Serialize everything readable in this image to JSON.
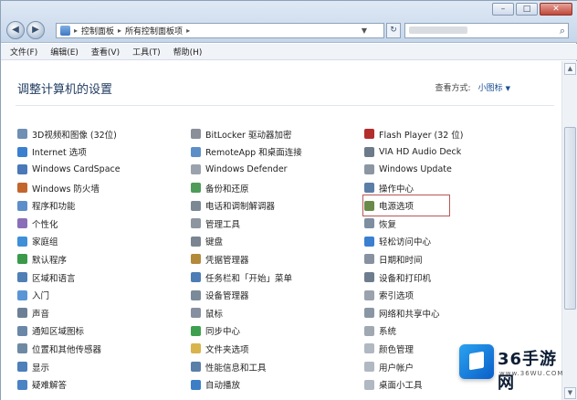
{
  "address": {
    "crumbs": [
      "控制面板",
      "所有控制面板项"
    ]
  },
  "menu": [
    "文件(F)",
    "编辑(E)",
    "查看(V)",
    "工具(T)",
    "帮助(H)"
  ],
  "heading": "调整计算机的设置",
  "view_by": {
    "label": "查看方式:",
    "value": "小图标"
  },
  "columns": [
    [
      {
        "label": "3D视频和图像 (32位)",
        "icon": "display-icon",
        "color": "#6f8fb3"
      },
      {
        "label": "Internet 选项",
        "icon": "globe-icon",
        "color": "#3b7fd0"
      },
      {
        "label": "Windows CardSpace",
        "icon": "card-icon",
        "color": "#4a78b8"
      },
      {
        "label": "Windows 防火墙",
        "icon": "firewall-icon",
        "color": "#c2662d"
      },
      {
        "label": "程序和功能",
        "icon": "programs-icon",
        "color": "#5d8ec9"
      },
      {
        "label": "个性化",
        "icon": "personalize-icon",
        "color": "#8a6fb8"
      },
      {
        "label": "家庭组",
        "icon": "homegroup-icon",
        "color": "#3e8fd8"
      },
      {
        "label": "默认程序",
        "icon": "default-programs-icon",
        "color": "#3a9a4a"
      },
      {
        "label": "区域和语言",
        "icon": "region-icon",
        "color": "#4f7fb5"
      },
      {
        "label": "入门",
        "icon": "getting-started-icon",
        "color": "#5b95d6"
      },
      {
        "label": "声音",
        "icon": "speaker-icon",
        "color": "#6d7f95"
      },
      {
        "label": "通知区域图标",
        "icon": "notification-icon",
        "color": "#6a87a8"
      },
      {
        "label": "位置和其他传感器",
        "icon": "sensor-icon",
        "color": "#6e8aa3"
      },
      {
        "label": "显示",
        "icon": "monitor-icon",
        "color": "#4d7fb8"
      },
      {
        "label": "疑难解答",
        "icon": "troubleshoot-icon",
        "color": "#4a82c4"
      }
    ],
    [
      {
        "label": "BitLocker 驱动器加密",
        "icon": "bitlocker-icon",
        "color": "#8a8f99"
      },
      {
        "label": "RemoteApp 和桌面连接",
        "icon": "remote-icon",
        "color": "#5c8fc8"
      },
      {
        "label": "Windows Defender",
        "icon": "defender-icon",
        "color": "#9aa2ad"
      },
      {
        "label": "备份和还原",
        "icon": "backup-icon",
        "color": "#4f9b5a"
      },
      {
        "label": "电话和调制解调器",
        "icon": "phone-icon",
        "color": "#7d8895"
      },
      {
        "label": "管理工具",
        "icon": "admin-tools-icon",
        "color": "#8d95a0"
      },
      {
        "label": "键盘",
        "icon": "keyboard-icon",
        "color": "#7b8591"
      },
      {
        "label": "凭据管理器",
        "icon": "credential-icon",
        "color": "#b38a3a"
      },
      {
        "label": "任务栏和「开始」菜单",
        "icon": "taskbar-icon",
        "color": "#4d7db5"
      },
      {
        "label": "设备管理器",
        "icon": "device-manager-icon",
        "color": "#7a8a9a"
      },
      {
        "label": "鼠标",
        "icon": "mouse-icon",
        "color": "#8790a0"
      },
      {
        "label": "同步中心",
        "icon": "sync-icon",
        "color": "#3ea04e"
      },
      {
        "label": "文件夹选项",
        "icon": "folder-icon",
        "color": "#d8b44a"
      },
      {
        "label": "性能信息和工具",
        "icon": "performance-icon",
        "color": "#5a7fa8"
      },
      {
        "label": "自动播放",
        "icon": "autoplay-icon",
        "color": "#3c7fc6"
      }
    ],
    [
      {
        "label": "Flash Player (32 位)",
        "icon": "flash-icon",
        "color": "#b32d2d"
      },
      {
        "label": "VIA HD Audio Deck",
        "icon": "audio-deck-icon",
        "color": "#6c7a8a"
      },
      {
        "label": "Windows Update",
        "icon": "update-icon",
        "color": "#8c96a2"
      },
      {
        "label": "操作中心",
        "icon": "action-center-icon",
        "color": "#5b7ea6"
      },
      {
        "label": "电源选项",
        "icon": "power-icon",
        "color": "#6a8a4a",
        "highlight": true
      },
      {
        "label": "恢复",
        "icon": "recovery-icon",
        "color": "#7e8ea0"
      },
      {
        "label": "轻松访问中心",
        "icon": "ease-access-icon",
        "color": "#3b7fd0"
      },
      {
        "label": "日期和时间",
        "icon": "clock-icon",
        "color": "#8791a0"
      },
      {
        "label": "设备和打印机",
        "icon": "printer-icon",
        "color": "#6d7d8e"
      },
      {
        "label": "索引选项",
        "icon": "index-icon",
        "color": "#9aa2ad"
      },
      {
        "label": "网络和共享中心",
        "icon": "network-icon",
        "color": "#8a96a4"
      },
      {
        "label": "系统",
        "icon": "system-icon",
        "color": "#a0a8b2"
      },
      {
        "label": "颜色管理",
        "icon": "color-icon",
        "color": "#b0b8c2"
      },
      {
        "label": "用户帐户",
        "icon": "user-icon",
        "color": "#b0b8c2"
      },
      {
        "label": "桌面小工具",
        "icon": "gadgets-icon",
        "color": "#b0b8c2"
      }
    ]
  ],
  "watermark": {
    "brand": "36手游网",
    "url": "www.36WU.COM"
  }
}
